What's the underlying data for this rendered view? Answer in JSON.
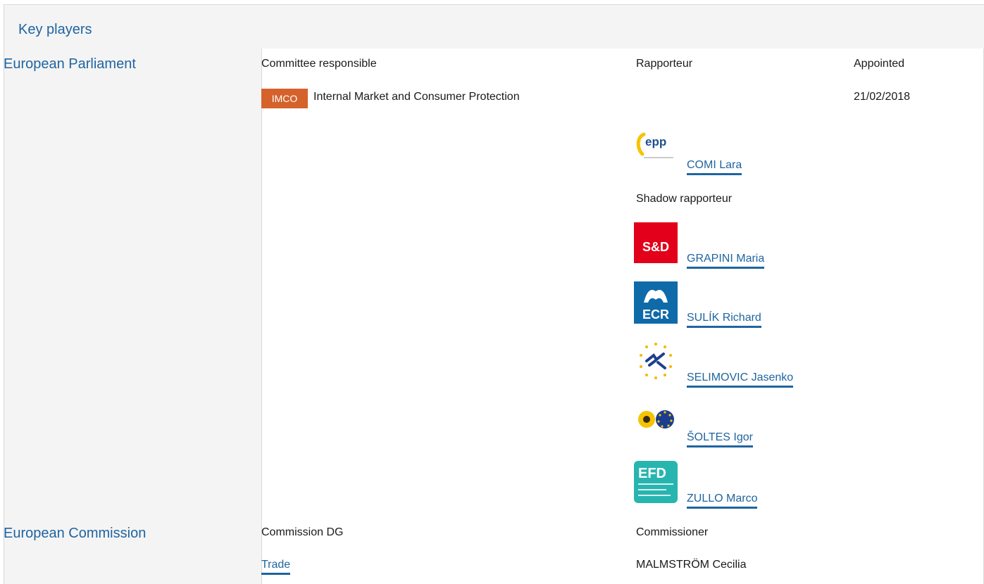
{
  "header": {
    "title": "Key players"
  },
  "ep": {
    "label": "European Parliament",
    "col_committee": "Committee responsible",
    "col_rapporteur": "Rapporteur",
    "col_appointed": "Appointed",
    "committee": {
      "badge": "IMCO",
      "name": "Internal Market and Consumer Protection",
      "appointed": "21/02/2018"
    },
    "rapporteur": {
      "name": "COMI Lara",
      "group_logo": "epp-logo"
    },
    "shadow_label": "Shadow rapporteur",
    "shadows": [
      {
        "name": "GRAPINI Maria",
        "group_logo": "sd-logo",
        "logo_text": "S&D"
      },
      {
        "name": "SULÍK Richard",
        "group_logo": "ecr-logo",
        "logo_text": "ECR"
      },
      {
        "name": "SELIMOVIC Jasenko",
        "group_logo": "alde-logo"
      },
      {
        "name": "ŠOLTES Igor",
        "group_logo": "greens-efa-logo"
      },
      {
        "name": "ZULLO Marco",
        "group_logo": "efdd-logo",
        "logo_text": "EFD"
      }
    ]
  },
  "ec": {
    "label": "European Commission",
    "col_dg": "Commission DG",
    "col_commissioner": "Commissioner",
    "dg": "Trade",
    "commissioner": "MALMSTRÖM Cecilia"
  },
  "colors": {
    "accent": "#1f64a0",
    "badge": "#d5622b",
    "panel": "#f4f4f4"
  }
}
